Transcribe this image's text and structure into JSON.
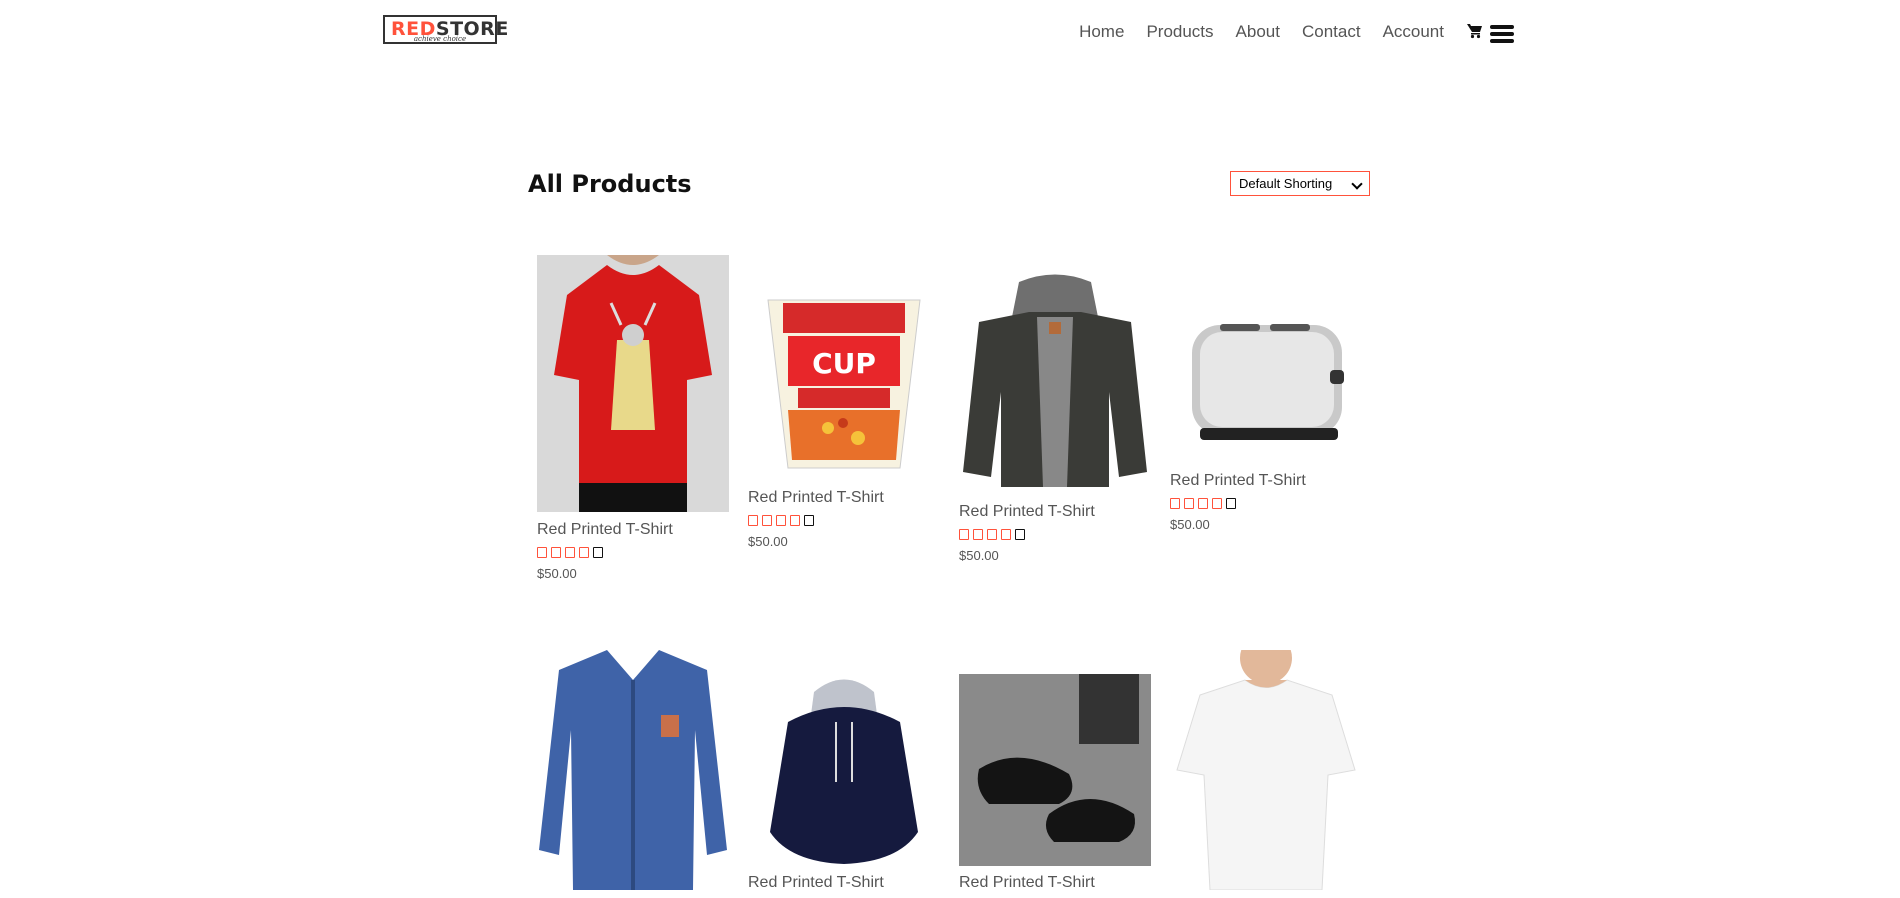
{
  "brand": {
    "name_red": "RED",
    "name_dark": "STORE",
    "tagline": "achieve choice"
  },
  "nav": {
    "items": [
      "Home",
      "Products",
      "About",
      "Contact",
      "Account"
    ],
    "cart_icon": "cart-icon",
    "menu_icon": "hamburger-menu-icon"
  },
  "page": {
    "title": "All Products",
    "sort": {
      "selected": "Default Shorting"
    }
  },
  "colors": {
    "accent": "#ff523b",
    "text": "#555555",
    "heading": "#111111"
  },
  "products": [
    {
      "name": "Red Printed T-Shirt",
      "price": "$50.00",
      "rating": 4,
      "max_rating": 5,
      "image": "red-printed-tshirt"
    },
    {
      "name": "Red Printed T-Shirt",
      "price": "$50.00",
      "rating": 4,
      "max_rating": 5,
      "image": "cup-noodles"
    },
    {
      "name": "Red Printed T-Shirt",
      "price": "$50.00",
      "rating": 4,
      "max_rating": 5,
      "image": "grey-hooded-jacket"
    },
    {
      "name": "Red Printed T-Shirt",
      "price": "$50.00",
      "rating": 4,
      "max_rating": 5,
      "image": "silver-toaster"
    },
    {
      "name": "",
      "price": "",
      "rating": null,
      "max_rating": null,
      "image": "blue-shirt"
    },
    {
      "name": "Red Printed T-Shirt",
      "price": "",
      "rating": null,
      "max_rating": null,
      "image": "navy-hoodie"
    },
    {
      "name": "Red Printed T-Shirt",
      "price": "",
      "rating": null,
      "max_rating": null,
      "image": "black-loafers"
    },
    {
      "name": "",
      "price": "",
      "rating": null,
      "max_rating": null,
      "image": "white-tshirt"
    }
  ]
}
